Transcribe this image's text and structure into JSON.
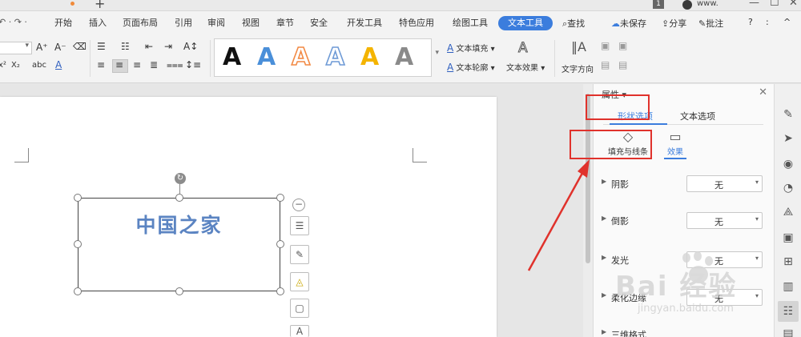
{
  "titlebar": {
    "new_tab_symbol": "+",
    "badge_text": "1",
    "site_text": "www.",
    "minimize_symbol": "—",
    "maximize_symbol": "☐",
    "close_symbol": "✕"
  },
  "menu": {
    "tabs": [
      {
        "label": "开始"
      },
      {
        "label": "插入"
      },
      {
        "label": "页面布局"
      },
      {
        "label": "引用"
      },
      {
        "label": "审阅"
      },
      {
        "label": "视图"
      },
      {
        "label": "章节"
      },
      {
        "label": "安全"
      },
      {
        "label": "开发工具"
      },
      {
        "label": "特色应用"
      },
      {
        "label": "绘图工具"
      },
      {
        "label": "文本工具"
      }
    ],
    "undo_redo_symbols": "↶ · ↷ ·",
    "search_label": "查找",
    "unsaved_label": "未保存",
    "share_label": "分享",
    "comment_label": "批注",
    "help_symbol": "?",
    "more_symbol": ":",
    "collapse_symbol": "^"
  },
  "ribbon": {
    "font_size_grow": "A⁺",
    "font_size_shrink": "A⁻",
    "superscript": "x²",
    "subscript": "X₂",
    "phonetic": "abc",
    "font_color": "A",
    "text_fill_label": "文本填充",
    "text_outline_label": "文本轮廓",
    "text_effect_label": "文本效果",
    "text_direction_label": "文字方向",
    "art_letter": "A",
    "art_styles": [
      {
        "color": "#111111",
        "style": "solid"
      },
      {
        "color": "#4a8fd9",
        "style": "solid"
      },
      {
        "color": "#f28a45",
        "style": "outline"
      },
      {
        "color": "#6f9bd6",
        "style": "outline"
      },
      {
        "color": "#f4b400",
        "style": "solid"
      },
      {
        "color": "#8a8a8a",
        "style": "gradient"
      }
    ]
  },
  "document": {
    "textbox_text": "中国之家",
    "rotate_symbol": "↻",
    "collapse_symbol": "−"
  },
  "panel": {
    "title": "属性",
    "close_symbol": "✕",
    "tabs": [
      {
        "label": "形状选项"
      },
      {
        "label": "文本选项"
      }
    ],
    "subtabs": [
      {
        "label": "填充与线条"
      },
      {
        "label": "效果"
      }
    ],
    "rows": [
      {
        "label": "阴影",
        "value": "无"
      },
      {
        "label": "倒影",
        "value": "无"
      },
      {
        "label": "发光",
        "value": "无"
      },
      {
        "label": "柔化边缘",
        "value": "无"
      },
      {
        "label": "三维格式",
        "value": ""
      }
    ]
  },
  "watermark": {
    "main": "Bai 经验",
    "sub": "jingyan.baidu.com"
  },
  "colors": {
    "accent": "#3b7ddd",
    "annotation_red": "#e0322c",
    "textbox_text": "#5b84c2"
  }
}
